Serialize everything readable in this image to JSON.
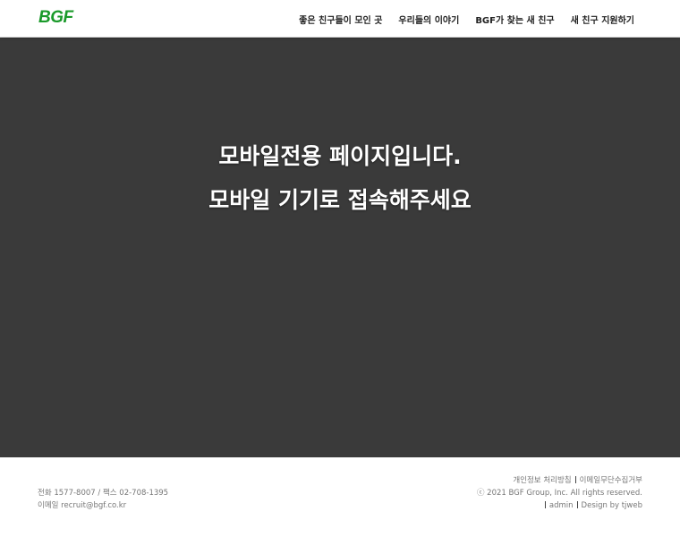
{
  "header": {
    "logo": "BGF",
    "nav": [
      "좋은 친구들이 모인 곳",
      "우리들의 이야기",
      "BGF가 찾는 새 친구",
      "새 친구 지원하기"
    ]
  },
  "hero": {
    "line1": "모바일전용 페이지입니다.",
    "line2": "모바일 기기로 접속해주세요"
  },
  "footer": {
    "contact": "전화 1577-8007 / 팩스 02-708-1395",
    "email": "이메일 recruit@bgf.co.kr",
    "privacy": "개인정보 처리방침",
    "email_policy": "이메일무단수집거부",
    "copyright": "ⓒ 2021 BGF Group, Inc. All rights reserved.",
    "admin": "admin",
    "design": "Design by tjweb"
  },
  "colors": {
    "brand": "#1a9a2a",
    "hero_bg": "#3a3a3a"
  }
}
